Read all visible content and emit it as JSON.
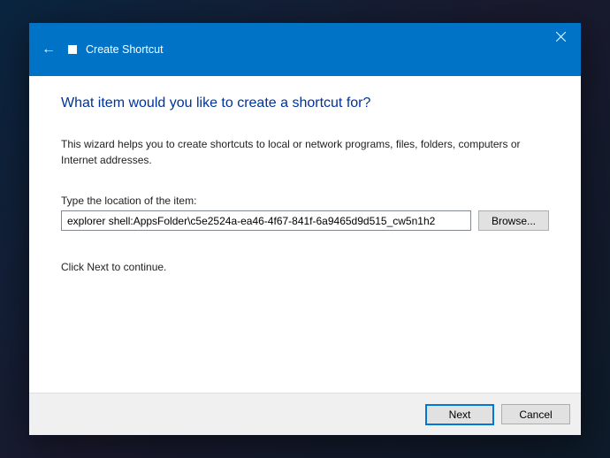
{
  "titlebar": {
    "title": "Create Shortcut"
  },
  "content": {
    "heading": "What item would you like to create a shortcut for?",
    "description": "This wizard helps you to create shortcuts to local or network programs, files, folders, computers or Internet addresses.",
    "field_label": "Type the location of the item:",
    "location_value": "explorer shell:AppsFolder\\c5e2524a-ea46-4f67-841f-6a9465d9d515_cw5n1h2",
    "browse_label": "Browse...",
    "continue_text": "Click Next to continue."
  },
  "footer": {
    "next_label": "Next",
    "cancel_label": "Cancel"
  }
}
